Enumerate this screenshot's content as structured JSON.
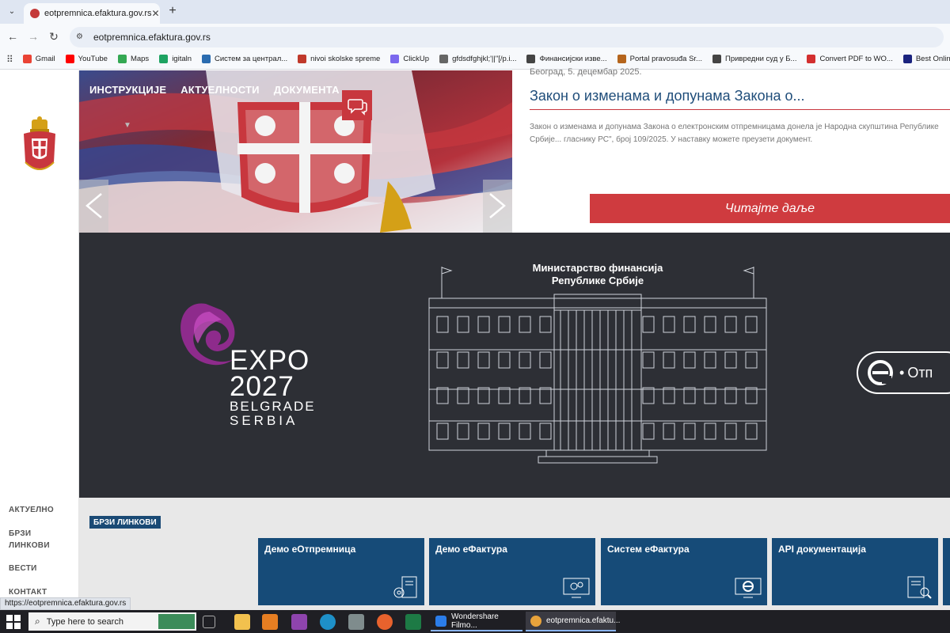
{
  "browser": {
    "tab_title": "eotpremnica.efaktura.gov.rs",
    "url": "eotpremnica.efaktura.gov.rs",
    "bookmarks": [
      {
        "label": "Gmail",
        "color": "#ea4335"
      },
      {
        "label": "YouTube",
        "color": "#ff0000"
      },
      {
        "label": "Maps",
        "color": "#34a853"
      },
      {
        "label": "igitaln",
        "color": "#1ea362"
      },
      {
        "label": "Систем за централ...",
        "color": "#2b6cb0"
      },
      {
        "label": "nivoi skolske spreme",
        "color": "#c0392b"
      },
      {
        "label": "ClickUp",
        "color": "#7b68ee"
      },
      {
        "label": "gfdsdfghjkl;'||\"[/p.i...",
        "color": "#666666"
      },
      {
        "label": "Финансијски изве...",
        "color": "#444444"
      },
      {
        "label": "Portal pravosuđa Sr...",
        "color": "#b5651d"
      },
      {
        "label": "Привредни суд у Б...",
        "color": "#444444"
      },
      {
        "label": "Convert PDF to WO...",
        "color": "#d32f2f"
      },
      {
        "label": "Best Online Docum",
        "color": "#1a237e"
      }
    ]
  },
  "sidebar": {
    "nav": [
      "АКТУЕЛНО",
      "БРЗИ",
      "ЛИНКОВИ",
      "ВЕСТИ",
      "КОНТАКТ"
    ]
  },
  "hero": {
    "nav": [
      "ИНСТРУКЦИЈЕ",
      "АКТУЕЛНОСТИ",
      "ДОКУМЕНТА"
    ],
    "news_date": "Београд, 5. децембар 2025.",
    "news_title": "Закон о изменама и допунама Закона о...",
    "news_body": "Закон о изменама и допунама Закона о електронским отпремницама донела је Народна скупштина Републике Србије... гласнику РС\", број 109/2025.   У наставку можете преузети документ.",
    "read_more": "Читајте даље"
  },
  "banner": {
    "ministry_line1": "Министарство финансија",
    "ministry_line2": "Републике Србије",
    "expo_line1": "EXPO",
    "expo_line2": "2027",
    "expo_line3": "BELGRADE",
    "expo_line4": "SERBIA",
    "eotp_label": "Отп"
  },
  "quick_links": {
    "title": "БРЗИ ЛИНКОВИ",
    "cards": [
      {
        "label": "Демо еОтпремница",
        "icon": "document-gear-icon"
      },
      {
        "label": "Демо еФактура",
        "icon": "monitor-gear-icon"
      },
      {
        "label": "Систем еФактура",
        "icon": "monitor-e-icon"
      },
      {
        "label": "API документација",
        "icon": "document-search-icon"
      }
    ]
  },
  "status_url": "https://eotpremnica.efaktura.gov.rs",
  "taskbar": {
    "search_placeholder": "Type here to search",
    "apps": [
      {
        "label": "Wondershare Filmo...",
        "color": "#2b7de9"
      },
      {
        "label": "eotpremnica.efaktu...",
        "color": "#e8a33b"
      }
    ]
  },
  "colors": {
    "accent_red": "#c8373e",
    "brand_blue": "#164b78",
    "banner_dark": "#2d2f35"
  }
}
